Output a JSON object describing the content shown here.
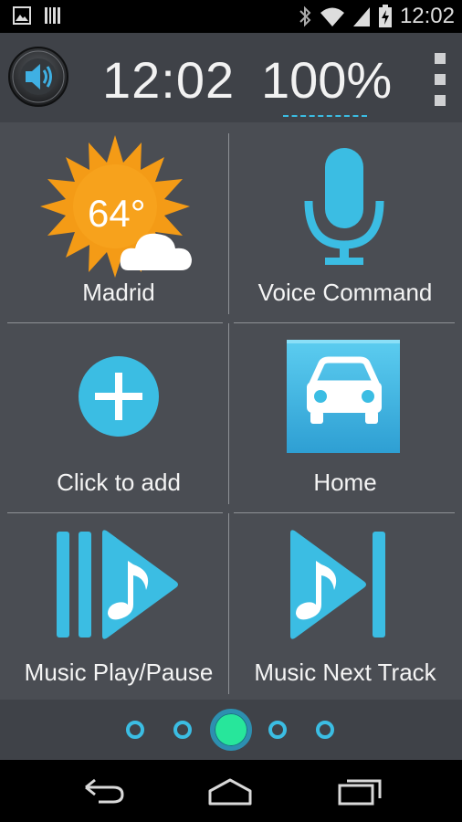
{
  "status_bar": {
    "time": "12:02",
    "icons": [
      "image-icon",
      "barcode-icon",
      "bluetooth-icon",
      "wifi-icon",
      "signal-icon",
      "battery-charging-icon"
    ]
  },
  "header": {
    "clock": "12:02",
    "battery": "100%",
    "speaker_icon": "speaker-icon",
    "menu_icon": "overflow-menu-icon"
  },
  "tiles": [
    {
      "label": "Madrid",
      "icon": "weather-sun-cloud-icon",
      "temperature": "64°"
    },
    {
      "label": "Voice Command",
      "icon": "microphone-icon"
    },
    {
      "label": "Click to add",
      "icon": "add-icon"
    },
    {
      "label": "Home",
      "icon": "car-icon"
    },
    {
      "label": "Music Play/Pause",
      "icon": "play-pause-icon"
    },
    {
      "label": "Music Next Track",
      "icon": "next-track-icon"
    }
  ],
  "pager": {
    "count": 5,
    "active_index": 2
  },
  "navigation": {
    "back": "back-icon",
    "home": "home-icon",
    "recents": "recents-icon"
  },
  "colors": {
    "accent": "#3bbde3",
    "active_dot": "#27e69b",
    "sun": "#f49b16",
    "background": "#4a4d53"
  }
}
